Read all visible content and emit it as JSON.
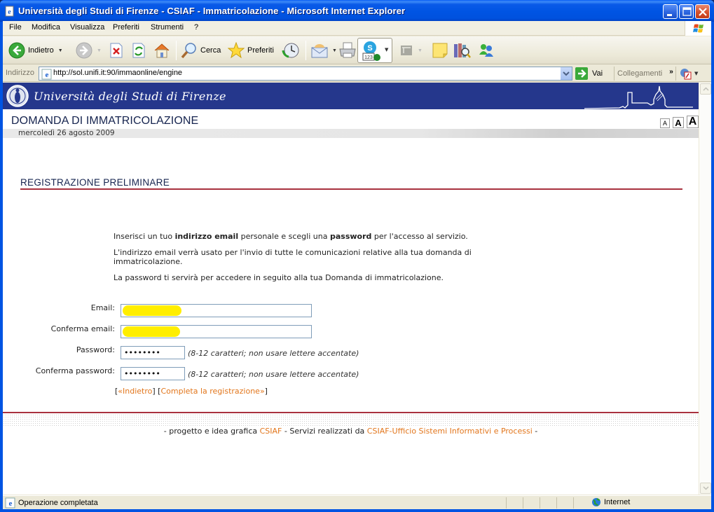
{
  "window": {
    "title": "Università degli Studi di Firenze - CSIAF - Immatricolazione - Microsoft Internet Explorer",
    "controls": [
      "minimize",
      "maximize",
      "close"
    ]
  },
  "menubar": {
    "items": [
      "File",
      "Modifica",
      "Visualizza",
      "Preferiti",
      "Strumenti",
      "?"
    ]
  },
  "toolbar": {
    "back_label": "Indietro",
    "search_label": "Cerca",
    "favorites_label": "Preferiti",
    "icons": [
      "back-icon",
      "forward-icon",
      "stop-icon",
      "refresh-icon",
      "home-icon",
      "search-icon",
      "favorites-star-icon",
      "history-icon",
      "mail-icon",
      "print-icon",
      "skype-icon",
      "toolbar-disabled-icon",
      "notes-icon",
      "research-icon",
      "messenger-icon"
    ]
  },
  "addressbar": {
    "label": "Indirizzo",
    "url": "http://sol.unifi.it:90/immaonline/engine",
    "go_label": "Vai",
    "links_label": "Collegamenti"
  },
  "page": {
    "university_name": "Università degli Studi di Firenze",
    "title": "DOMANDA DI IMMATRICOLAZIONE",
    "date": "mercoledì 26 agosto 2009",
    "font_size_buttons": [
      "A",
      "A",
      "A"
    ],
    "section_title": "REGISTRAZIONE PRELIMINARE",
    "intro": {
      "p1_pre": "Inserisci un tuo ",
      "p1_bold1": "indirizzo email",
      "p1_mid": " personale e scegli una ",
      "p1_bold2": "password",
      "p1_post": " per l'accesso al servizio.",
      "p2": "L'indirizzo email verrà usato per l'invio di tutte le comunicazioni relative alla tua domanda di immatricolazione.",
      "p3": "La password ti servirà per accedere in seguito alla tua Domanda di immatricolazione."
    },
    "form": {
      "email_label": "Email:",
      "email_value": "[redacted]",
      "confirm_email_label": "Conferma email:",
      "confirm_email_value": "[redacted]",
      "password_label": "Password:",
      "password_value": "••••••••",
      "confirm_password_label": "Conferma password:",
      "confirm_password_value": "••••••••",
      "password_hint": "(8-12 caratteri; non usare lettere accentate)"
    },
    "actions": {
      "back_label": "«Indietro",
      "complete_label": "Completa la registrazione»"
    },
    "footer": {
      "pre": "- progetto e idea grafica ",
      "link1": "CSIAF",
      "mid": " - Servizi realizzati da ",
      "link2": "CSIAF-Ufficio Sistemi Informativi e Processi",
      "post": " -"
    }
  },
  "statusbar": {
    "text": "Operazione completata",
    "zone": "Internet"
  },
  "colors": {
    "header_blue": "#25378c",
    "accent_red": "#a8313e",
    "link_orange": "#e2761c",
    "redaction_yellow": "#ffee00"
  }
}
